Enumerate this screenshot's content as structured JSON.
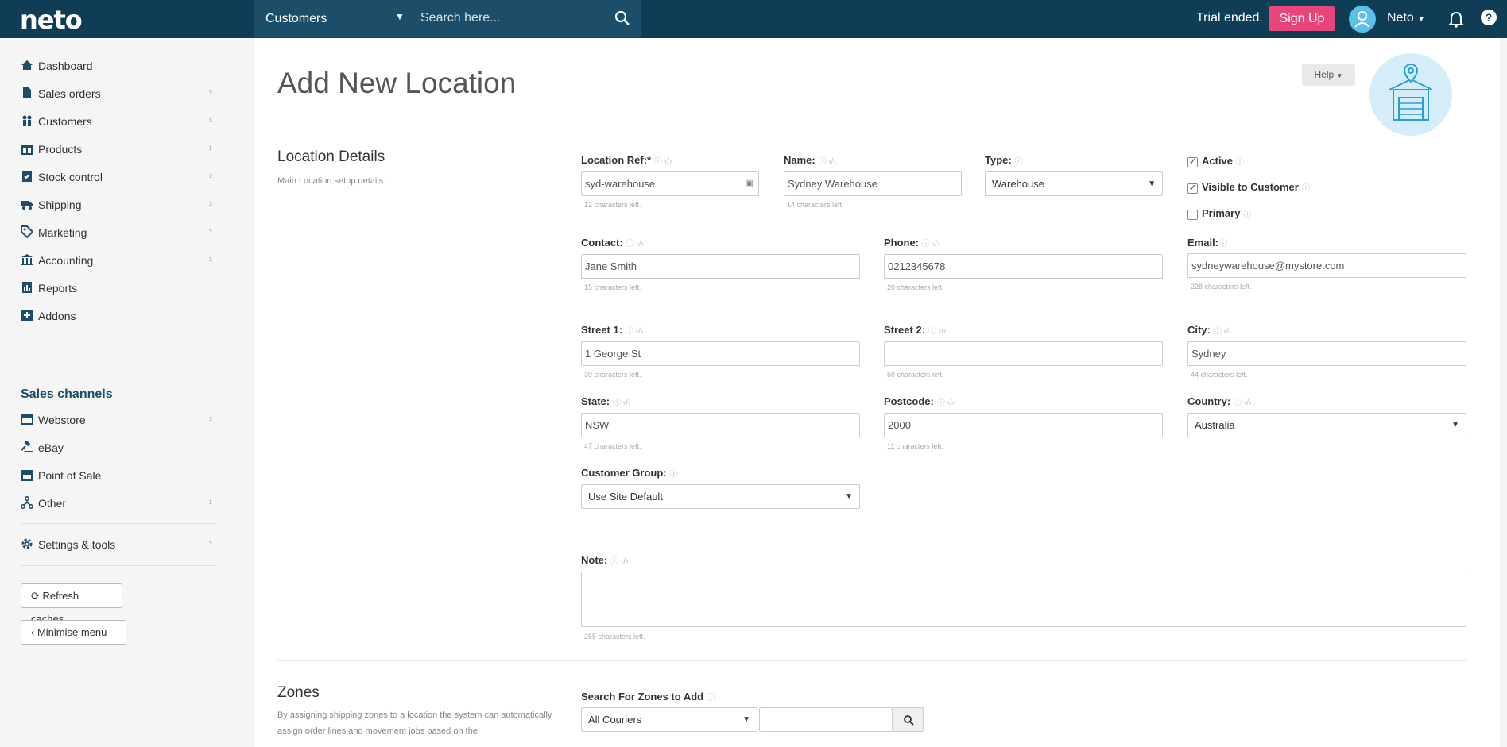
{
  "topbar": {
    "logo": "neto",
    "search_scope": "Customers",
    "search_placeholder": "Search here...",
    "trial_text": "Trial ended.",
    "signup_label": "Sign Up",
    "user_name": "Neto"
  },
  "sidebar": {
    "items": [
      {
        "label": "Dashboard",
        "icon": "home-icon",
        "has_chevron": false
      },
      {
        "label": "Sales orders",
        "icon": "document-icon",
        "has_chevron": true
      },
      {
        "label": "Customers",
        "icon": "people-icon",
        "has_chevron": true
      },
      {
        "label": "Products",
        "icon": "gift-icon",
        "has_chevron": true
      },
      {
        "label": "Stock control",
        "icon": "checklist-icon",
        "has_chevron": true
      },
      {
        "label": "Shipping",
        "icon": "truck-icon",
        "has_chevron": true
      },
      {
        "label": "Marketing",
        "icon": "tag-icon",
        "has_chevron": true
      },
      {
        "label": "Accounting",
        "icon": "bank-icon",
        "has_chevron": true
      },
      {
        "label": "Reports",
        "icon": "report-icon",
        "has_chevron": false
      },
      {
        "label": "Addons",
        "icon": "plus-square-icon",
        "has_chevron": false
      }
    ],
    "channels_heading": "Sales channels",
    "channels": [
      {
        "label": "Webstore",
        "icon": "webstore-icon",
        "has_chevron": true
      },
      {
        "label": "eBay",
        "icon": "gavel-icon",
        "has_chevron": false
      },
      {
        "label": "Point of Sale",
        "icon": "store-icon",
        "has_chevron": false
      },
      {
        "label": "Other",
        "icon": "sitemap-icon",
        "has_chevron": true
      }
    ],
    "settings": {
      "label": "Settings & tools",
      "icon": "gear-icon",
      "has_chevron": true
    },
    "refresh_label": "Refresh caches",
    "minimise_label": "Minimise menu"
  },
  "page": {
    "title": "Add New Location",
    "help_label": "Help"
  },
  "location_details": {
    "title": "Location Details",
    "description": "Main Location setup details.",
    "location_ref": {
      "label": "Location Ref:*",
      "value": "syd-warehouse",
      "hint": "12 characters left."
    },
    "name": {
      "label": "Name:",
      "value": "Sydney Warehouse",
      "hint": "14 characters left."
    },
    "type": {
      "label": "Type:",
      "value": "Warehouse"
    },
    "active": {
      "label": "Active",
      "checked": true
    },
    "visible": {
      "label": "Visible to Customer",
      "checked": true
    },
    "primary": {
      "label": "Primary",
      "checked": false
    },
    "contact": {
      "label": "Contact:",
      "value": "Jane Smith",
      "hint": "15 characters left."
    },
    "phone": {
      "label": "Phone:",
      "value": "0212345678",
      "hint": "20 characters left."
    },
    "email": {
      "label": "Email:",
      "value": "sydneywarehouse@mystore.com",
      "hint": "228 characters left."
    },
    "street1": {
      "label": "Street 1:",
      "value": "1 George St",
      "hint": "39 characters left."
    },
    "street2": {
      "label": "Street 2:",
      "value": "",
      "hint": "50 characters left."
    },
    "city": {
      "label": "City:",
      "value": "Sydney",
      "hint": "44 characters left."
    },
    "state": {
      "label": "State:",
      "value": "NSW",
      "hint": "47 characters left."
    },
    "postcode": {
      "label": "Postcode:",
      "value": "2000",
      "hint": "11 characters left."
    },
    "country": {
      "label": "Country:",
      "value": "Australia"
    },
    "customer_group": {
      "label": "Customer Group:",
      "value": "Use Site Default"
    },
    "note": {
      "label": "Note:",
      "value": "",
      "hint": "255 characters left."
    }
  },
  "zones": {
    "title": "Zones",
    "description": "By assigning shipping zones to a location the system can automatically assign order lines and movement jobs based on the",
    "search_label": "Search For Zones to Add",
    "courier_value": "All Couriers",
    "zone_query": ""
  },
  "colors": {
    "topbar": "#0f3d56",
    "signup": "#e8457b",
    "accent": "#5bc0e8"
  }
}
